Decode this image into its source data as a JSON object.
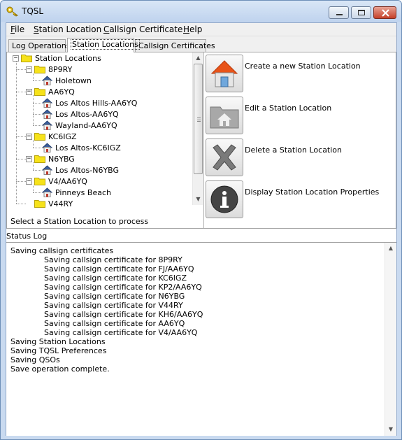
{
  "window": {
    "title": "TQSL"
  },
  "menu": [
    {
      "label": "File"
    },
    {
      "label": "Station Location"
    },
    {
      "label": "Callsign Certificate"
    },
    {
      "label": "Help"
    }
  ],
  "tabs": [
    {
      "label": "Log Operations",
      "active": false
    },
    {
      "label": "Station Locations",
      "active": true
    },
    {
      "label": "Callsign Certificates",
      "active": false
    }
  ],
  "tree": {
    "root": "Station Locations",
    "nodes": [
      {
        "callsign": "8P9RY",
        "locations": [
          "Holetown"
        ]
      },
      {
        "callsign": "AA6YQ",
        "locations": [
          "Los Altos Hills-AA6YQ",
          "Los Altos-AA6YQ",
          "Wayland-AA6YQ"
        ]
      },
      {
        "callsign": "KC6IGZ",
        "locations": [
          "Los Altos-KC6IGZ"
        ]
      },
      {
        "callsign": "N6YBG",
        "locations": [
          "Los Altos-N6YBG"
        ]
      },
      {
        "callsign": "V4/AA6YQ",
        "locations": [
          "Pinneys Beach"
        ]
      },
      {
        "callsign": "V44RY",
        "locations": []
      }
    ],
    "hint": "Select a Station Location to process"
  },
  "actions": [
    {
      "label": "Create a new Station Location",
      "icon": "house-icon"
    },
    {
      "label": "Edit a Station Location",
      "icon": "folder-house-icon"
    },
    {
      "label": "Delete a Station Location",
      "icon": "delete-x-icon"
    },
    {
      "label": "Display Station Location Properties",
      "icon": "info-icon"
    }
  ],
  "status": {
    "label": "Status Log",
    "lines": [
      {
        "text": "Saving callsign certificates",
        "indent": 0
      },
      {
        "text": "Saving callsign certificate for 8P9RY",
        "indent": 1
      },
      {
        "text": "Saving callsign certificate for FJ/AA6YQ",
        "indent": 1
      },
      {
        "text": "Saving callsign certificate for KC6IGZ",
        "indent": 1
      },
      {
        "text": "Saving callsign certificate for KP2/AA6YQ",
        "indent": 1
      },
      {
        "text": "Saving callsign certificate for N6YBG",
        "indent": 1
      },
      {
        "text": "Saving callsign certificate for V44RY",
        "indent": 1
      },
      {
        "text": "Saving callsign certificate for KH6/AA6YQ",
        "indent": 1
      },
      {
        "text": "Saving callsign certificate for AA6YQ",
        "indent": 1
      },
      {
        "text": "Saving callsign certificate for V4/AA6YQ",
        "indent": 1
      },
      {
        "text": "Saving Station Locations",
        "indent": 0
      },
      {
        "text": "Saving TQSL Preferences",
        "indent": 0
      },
      {
        "text": "Saving QSOs",
        "indent": 0
      },
      {
        "text": "Save operation complete.",
        "indent": 0
      }
    ]
  }
}
